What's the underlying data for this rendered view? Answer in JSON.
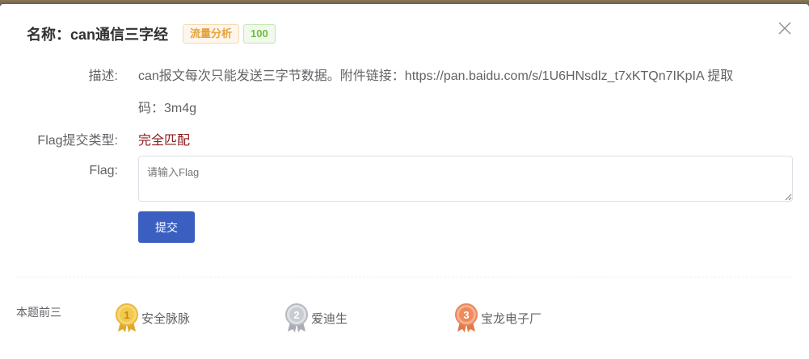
{
  "dialog": {
    "title": "名称：can通信三字经",
    "tags": [
      {
        "label": "流量分析",
        "color": "#e6a23c"
      },
      {
        "label": "100",
        "color": "#67c23a"
      }
    ],
    "close_icon": "close-icon"
  },
  "fields": {
    "description_label": "描述:",
    "description_line1": "can报文每次只能发送三字节数据。附件链接：https://pan.baidu.com/s/1U6HNsdlz_t7xKTQn7IKpIA 提取",
    "description_line2": "码：3m4g",
    "flag_type_label": "Flag提交类型:",
    "flag_type_value": "完全匹配",
    "flag_label": "Flag:",
    "flag_placeholder": "请输入Flag",
    "flag_value": ""
  },
  "actions": {
    "submit_label": "提交",
    "submit_color": "#3a5fc0"
  },
  "top3": {
    "label": "本题前三",
    "entries": [
      {
        "rank": "1",
        "name": "安全脉脉",
        "medal": "gold-medal-icon",
        "color": "#f2c94c"
      },
      {
        "rank": "2",
        "name": "爱迪生",
        "medal": "silver-medal-icon",
        "color": "#b8bcc4"
      },
      {
        "rank": "3",
        "name": "宝龙电子厂",
        "medal": "bronze-medal-icon",
        "color": "#ee8a5c"
      }
    ]
  }
}
